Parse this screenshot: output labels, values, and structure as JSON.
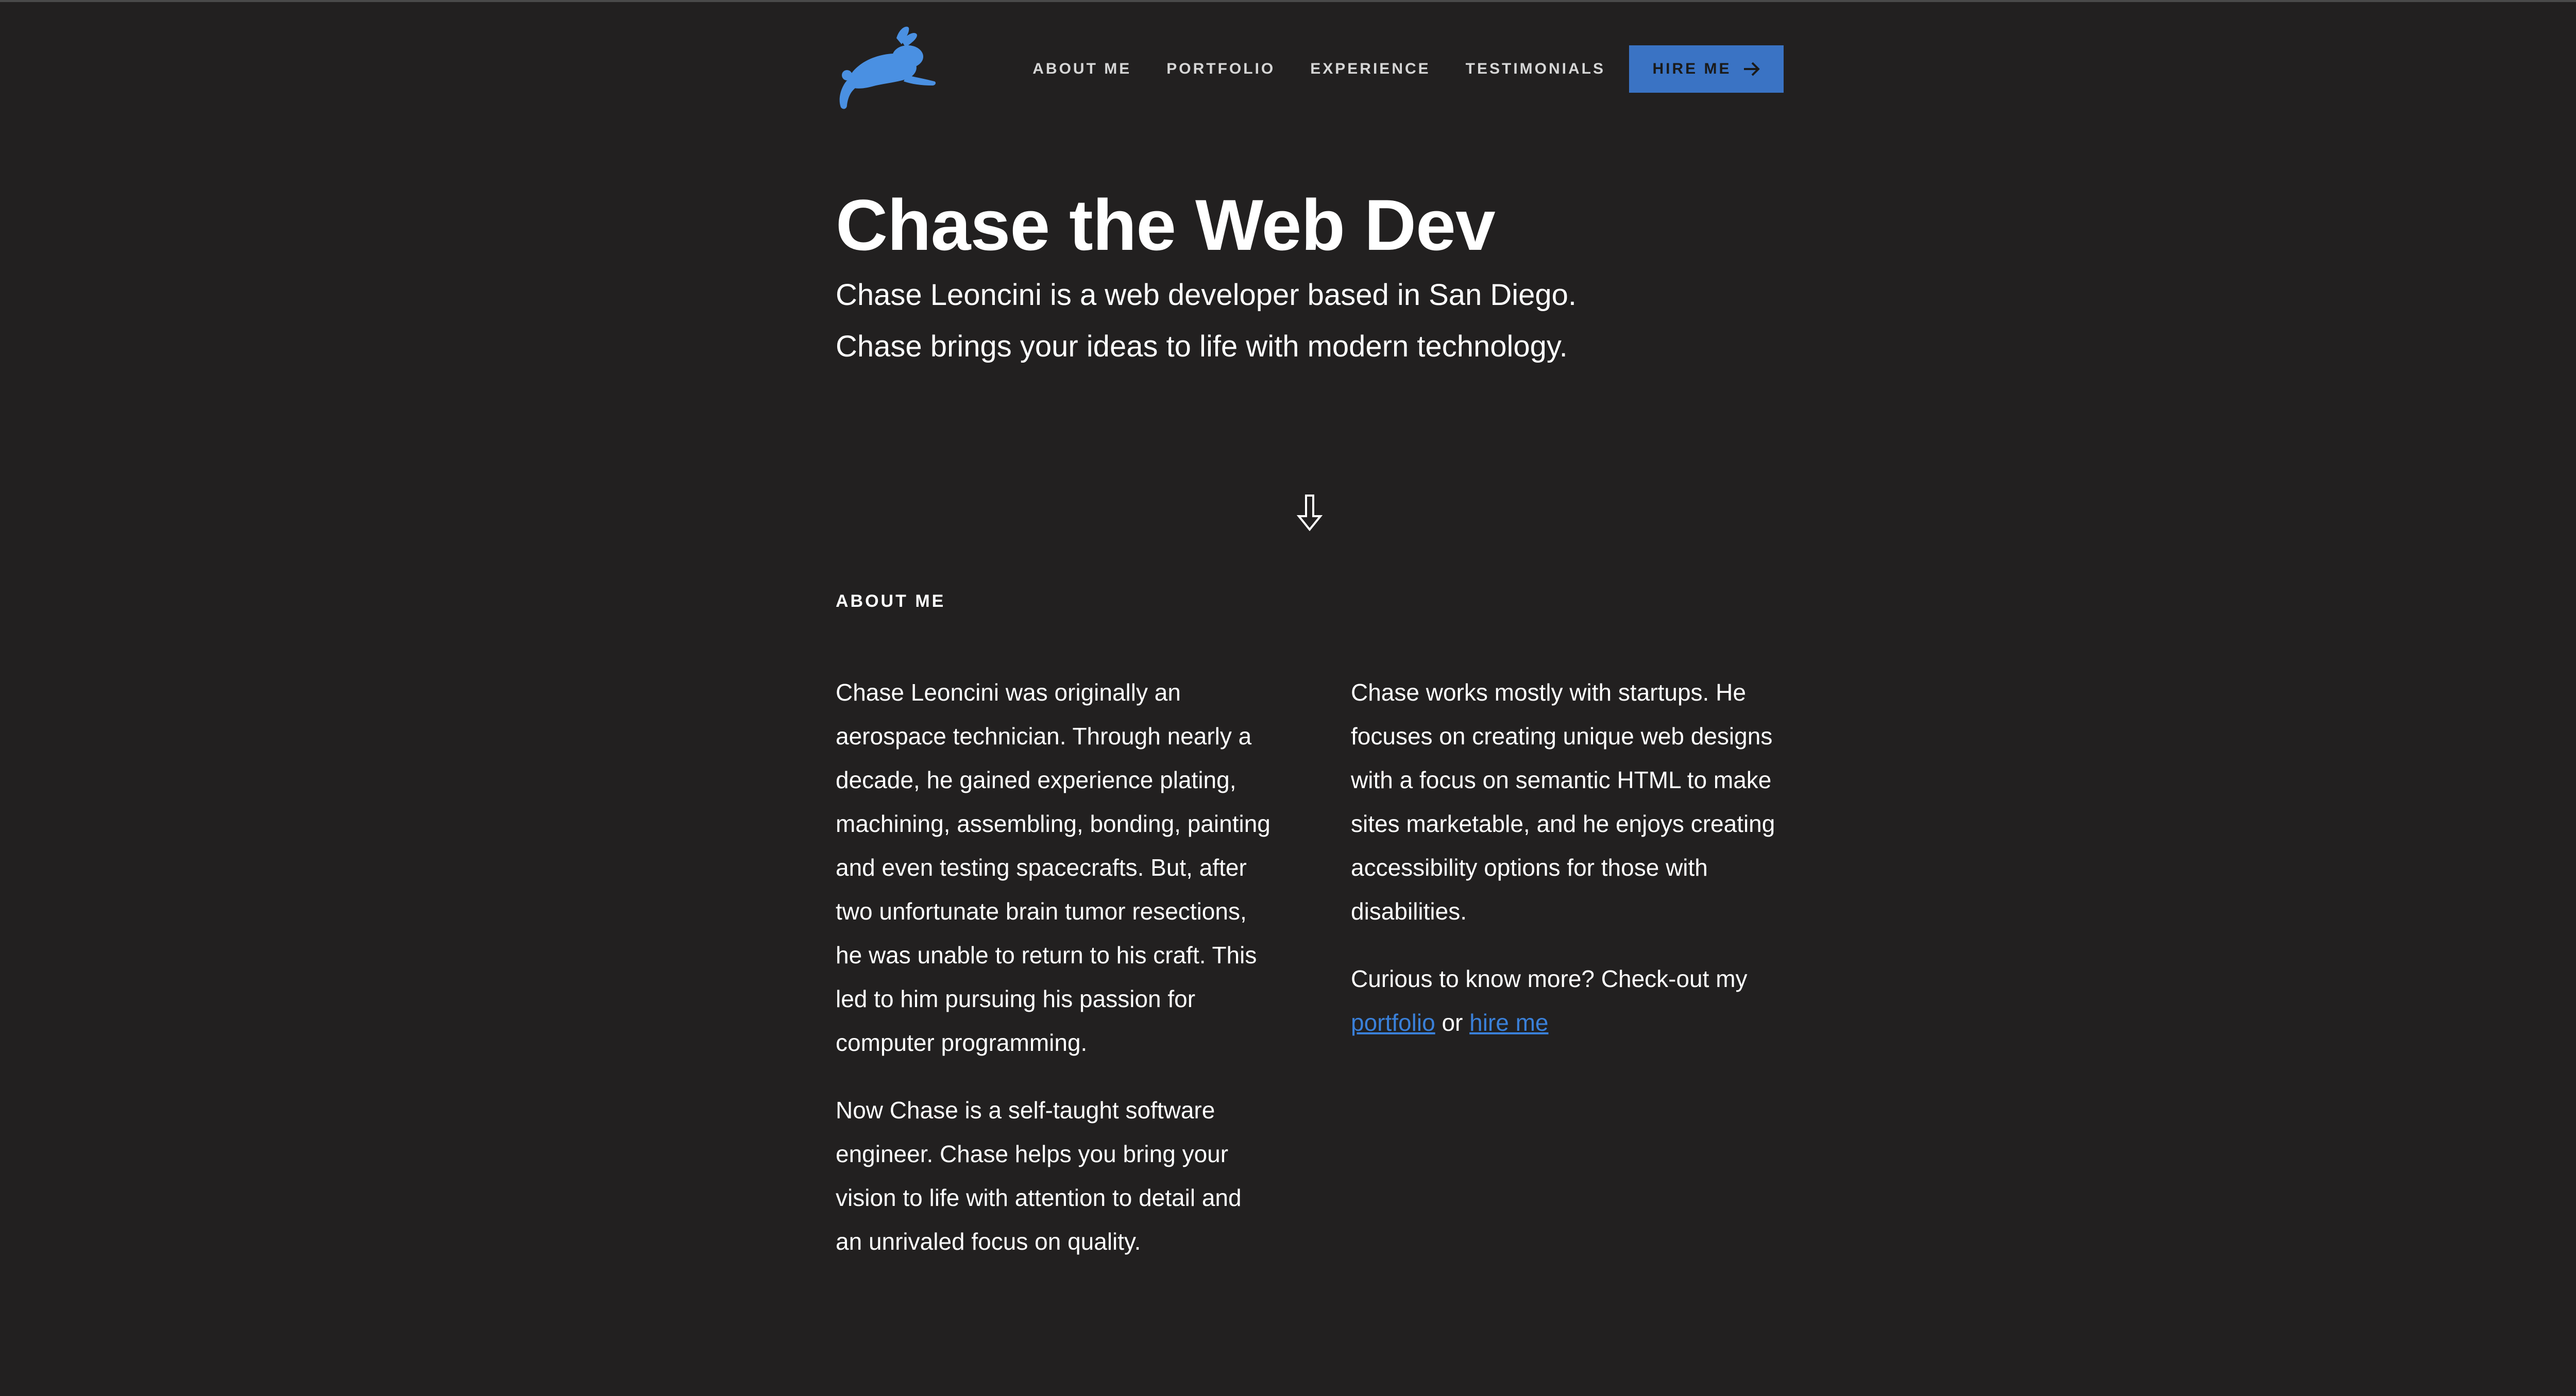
{
  "nav": {
    "items": [
      "ABOUT ME",
      "PORTFOLIO",
      "EXPERIENCE",
      "TESTIMONIALS"
    ],
    "hire_label": "HIRE ME"
  },
  "hero": {
    "title": "Chase the Web Dev",
    "line1": "Chase Leoncini is a web developer based in San Diego.",
    "line2": "Chase brings your ideas to life with modern technology."
  },
  "about": {
    "heading": "ABOUT ME",
    "left": [
      "Chase Leoncini was originally an aerospace technician. Through nearly a decade, he gained experience plating, machining, assembling, bonding, painting and even testing spacecrafts. But, after two unfortunate brain tumor resections, he was unable to return to his craft. This led to him pursuing his passion for computer programming.",
      "Now Chase is a self-taught software engineer. Chase helps you bring your vision to life with attention to detail and an unrivaled focus on quality."
    ],
    "right": "Chase works mostly with startups. He focuses on creating unique web designs with a focus on semantic HTML to make sites marketable, and he enjoys creating accessibility options for those with disabilities.",
    "cta_text": "Curious to know more? Check-out my",
    "portfolio_link": "portfolio",
    "or_text": "or",
    "hire_link": "hire me"
  },
  "icons": {
    "logo": "rabbit-logo",
    "theme": "moon-icon",
    "hire_arrow": "arrow-right-icon",
    "scroll": "arrow-down-icon"
  },
  "colors": {
    "background": "#222020",
    "accent": "#3a73c4",
    "logo": "#4a90e2",
    "link": "#3a80d9"
  }
}
